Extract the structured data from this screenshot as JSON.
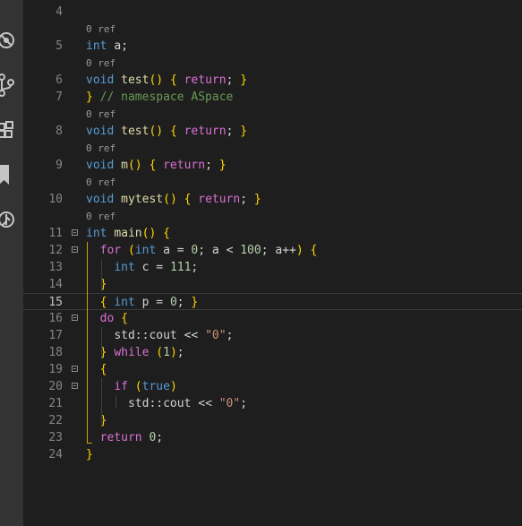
{
  "activity_bar": {
    "icons": [
      "no-bugs-icon",
      "source-control-icon",
      "extensions-icon",
      "bookmark-icon",
      "remote-explorer-icon"
    ]
  },
  "editor": {
    "current_line": "15",
    "lines": [
      {
        "kind": "code",
        "num": "4",
        "text": ""
      },
      {
        "kind": "lens",
        "text": "0 ref"
      },
      {
        "kind": "code",
        "num": "5",
        "text": "int a;"
      },
      {
        "kind": "lens",
        "text": "0 ref"
      },
      {
        "kind": "code",
        "num": "6",
        "text": "void test() { return; }"
      },
      {
        "kind": "code",
        "num": "7",
        "text": "} // namespace ASpace"
      },
      {
        "kind": "lens",
        "text": "0 ref"
      },
      {
        "kind": "code",
        "num": "8",
        "text": "void test() { return; }"
      },
      {
        "kind": "lens",
        "text": "0 ref"
      },
      {
        "kind": "code",
        "num": "9",
        "text": "void m() { return; }"
      },
      {
        "kind": "lens",
        "text": "0 ref"
      },
      {
        "kind": "code",
        "num": "10",
        "text": "void mytest() { return; }"
      },
      {
        "kind": "lens",
        "text": "0 ref"
      },
      {
        "kind": "code",
        "num": "11",
        "text": "int main() {"
      },
      {
        "kind": "code",
        "num": "12",
        "text": "  for (int a = 0; a < 100; a++) {"
      },
      {
        "kind": "code",
        "num": "13",
        "text": "    int c = 111;"
      },
      {
        "kind": "code",
        "num": "14",
        "text": "  }"
      },
      {
        "kind": "code",
        "num": "15",
        "text": "  { int p = 0; }"
      },
      {
        "kind": "code",
        "num": "16",
        "text": "  do {"
      },
      {
        "kind": "code",
        "num": "17",
        "text": "    std::cout << \"0\";"
      },
      {
        "kind": "code",
        "num": "18",
        "text": "  } while (1);"
      },
      {
        "kind": "code",
        "num": "19",
        "text": "  {"
      },
      {
        "kind": "code",
        "num": "20",
        "text": "    if (true)"
      },
      {
        "kind": "code",
        "num": "21",
        "text": "      std::cout << \"0\";"
      },
      {
        "kind": "code",
        "num": "22",
        "text": "  }"
      },
      {
        "kind": "code",
        "num": "23",
        "text": "  return 0;"
      },
      {
        "kind": "code",
        "num": "24",
        "text": "}"
      }
    ]
  }
}
